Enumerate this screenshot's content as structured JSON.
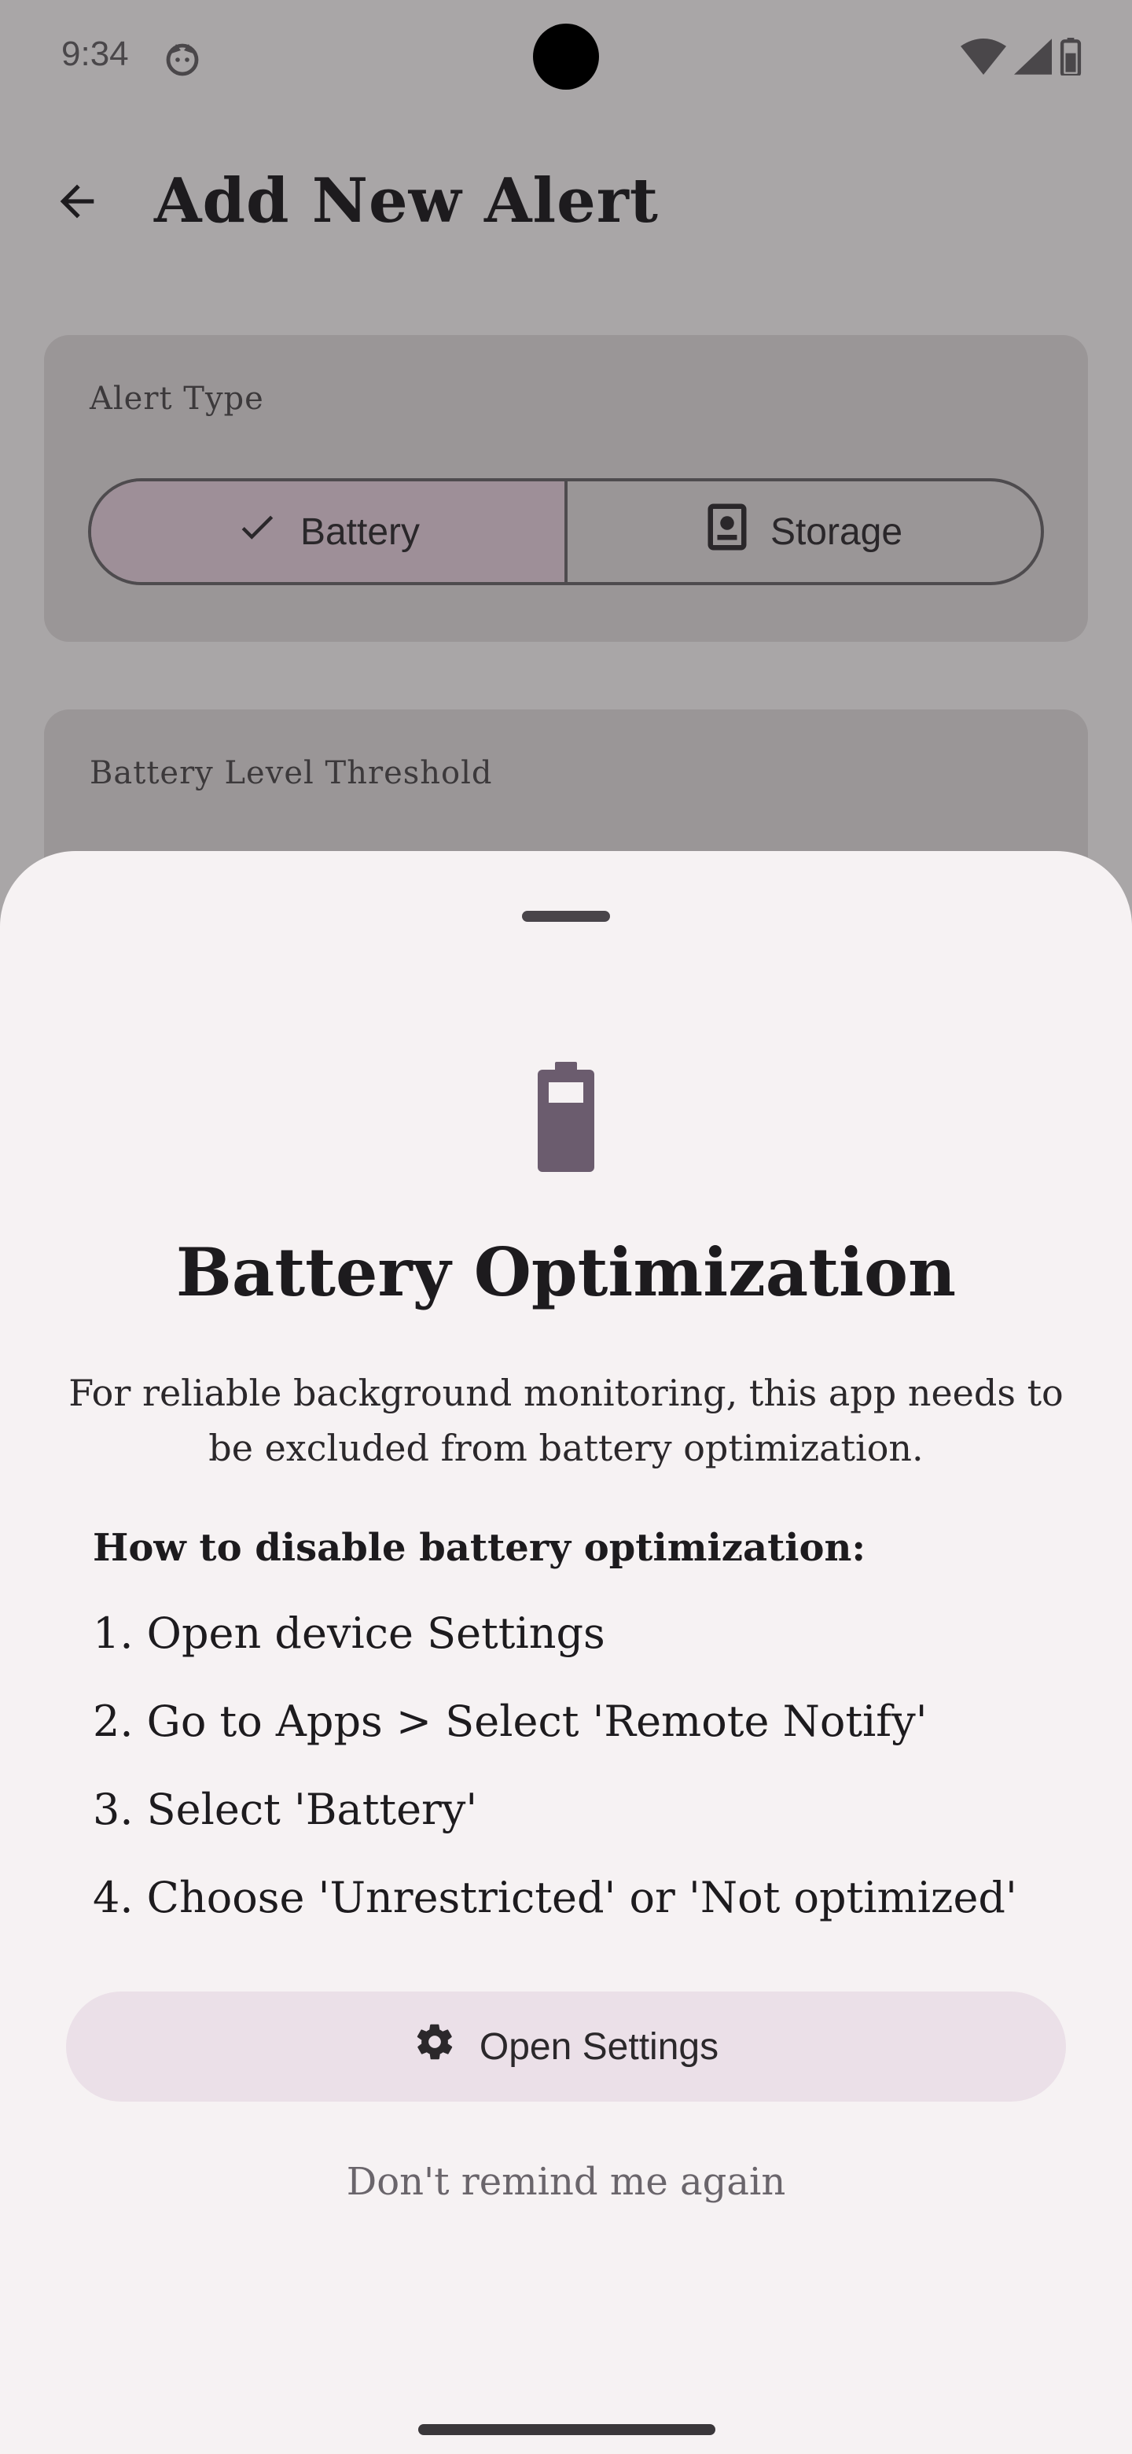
{
  "status_bar": {
    "time": "9:34"
  },
  "header": {
    "title": "Add New Alert"
  },
  "alert_type": {
    "label": "Alert Type",
    "options": [
      {
        "label": "Battery",
        "selected": true
      },
      {
        "label": "Storage",
        "selected": false
      }
    ]
  },
  "threshold": {
    "label": "Battery Level Threshold"
  },
  "sheet": {
    "title": "Battery Optimization",
    "description": "For reliable background monitoring, this app needs to be excluded from battery optimization.",
    "howto_heading": "How to disable battery optimization:",
    "steps": [
      "1. Open device Settings",
      "2. Go to Apps > Select 'Remote Notify'",
      "3. Select 'Battery'",
      "4. Choose 'Unrestricted' or 'Not optimized'"
    ],
    "primary_button": "Open Settings",
    "secondary_button": "Don't remind me again"
  },
  "colors": {
    "scrim": "#a9a6a7",
    "sheet_bg": "#f6f2f3",
    "tonal_button": "#ebe0e8",
    "icon_accent": "#6b5c6e"
  },
  "icons": [
    "back-arrow-icon",
    "check-icon",
    "storage-icon",
    "battery-icon",
    "gear-icon",
    "wifi-icon",
    "signal-icon",
    "battery-status-icon",
    "app-notification-icon"
  ]
}
